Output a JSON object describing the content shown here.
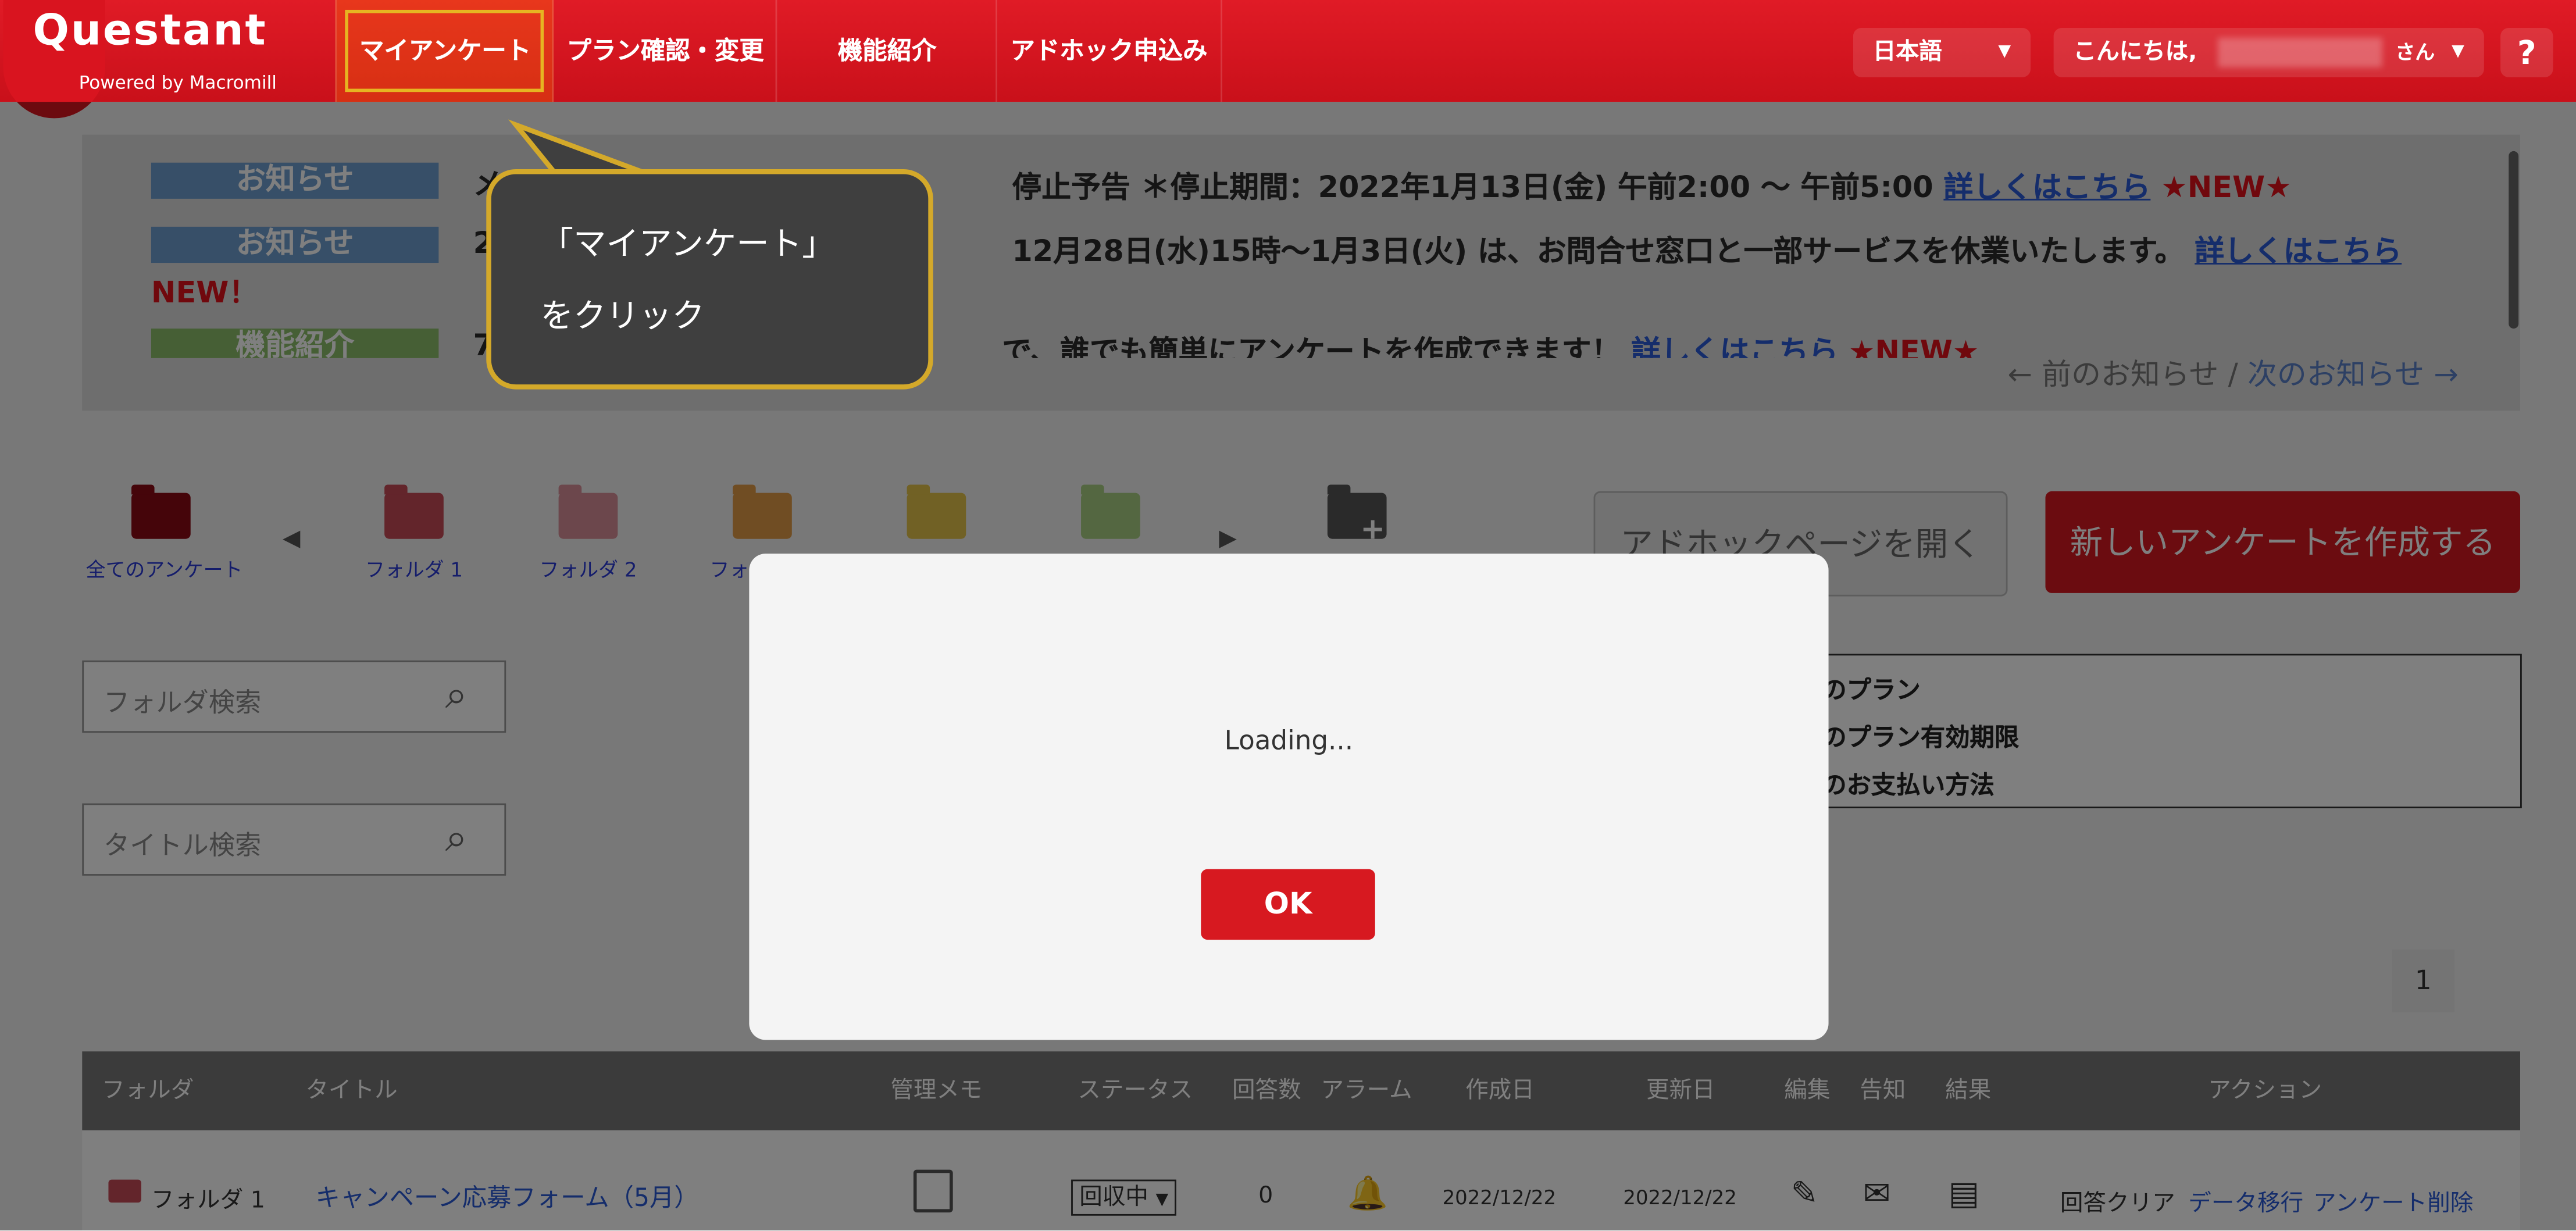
{
  "logo": {
    "name": "Questant",
    "sub": "Powered by Macromill"
  },
  "nav": [
    {
      "label": "マイアンケート"
    },
    {
      "label": "プラン確認・変更"
    },
    {
      "label": "機能紹介"
    },
    {
      "label": "アドホック申込み"
    }
  ],
  "header": {
    "language": "日本語",
    "greeting": "こんにちは,",
    "honorific": "さん",
    "help": "?"
  },
  "notices": [
    {
      "tag": "お知らせ",
      "text_a": "メ",
      "text_b": "停止予告 ＊停止期間：2022年1月13日(金) 午前2:00 〜 午前5:00",
      "link": "詳しくはこちら",
      "new": "★NEW★"
    },
    {
      "tag": "お知らせ",
      "text_a": "2",
      "text_b": "12月28日(水)15時〜1月3日(火) は、お問合せ窓口と一部サービスを休業いたします。",
      "link": "詳しくはこちら",
      "new": "NEW！"
    },
    {
      "tag": "機能紹介",
      "text_a": "7",
      "text_b": "で、誰でも簡単にアンケートを作成できます！",
      "link": "詳しくはこちら",
      "new": "★NEW★"
    }
  ],
  "notice_nav": {
    "prev": "← 前のお知らせ",
    "sep": "/",
    "next": "次のお知らせ →"
  },
  "folders": [
    {
      "label": "全てのアンケート"
    },
    {
      "label": "フォルダ 1"
    },
    {
      "label": "フォルダ 2"
    },
    {
      "label": "フォ"
    }
  ],
  "buttons": {
    "adhoc": "アドホックページを開く",
    "new_survey": "新しいアンケートを作成する"
  },
  "search": {
    "folder_placeholder": "フォルダ検索",
    "title_placeholder": "タイトル検索"
  },
  "plan_info": [
    "のプラン",
    "のプラン有効期限",
    "のお支払い方法"
  ],
  "pagination": {
    "page": "1"
  },
  "table": {
    "headers": [
      "フォルダ",
      "タイトル",
      "管理メモ",
      "ステータス",
      "回答数",
      "アラーム",
      "作成日",
      "更新日",
      "編集",
      "告知",
      "結果",
      "アクション"
    ],
    "row": {
      "folder": "フォルダ 1",
      "title": "キャンペーン応募フォーム（5月）",
      "status": "回収中",
      "count": "0",
      "created": "2022/12/22",
      "updated": "2022/12/22",
      "action_clear": "回答クリア",
      "action_migrate": "データ移行",
      "action_delete": "アンケート削除"
    }
  },
  "dialog": {
    "message": "Loading...",
    "ok": "OK"
  },
  "tooltip": {
    "line1": "「マイアンケート」",
    "line2": "をクリック"
  },
  "colors": {
    "brand_red": "#d9141f",
    "tooltip_border": "#d4a92a",
    "link": "#2a5bd7"
  }
}
